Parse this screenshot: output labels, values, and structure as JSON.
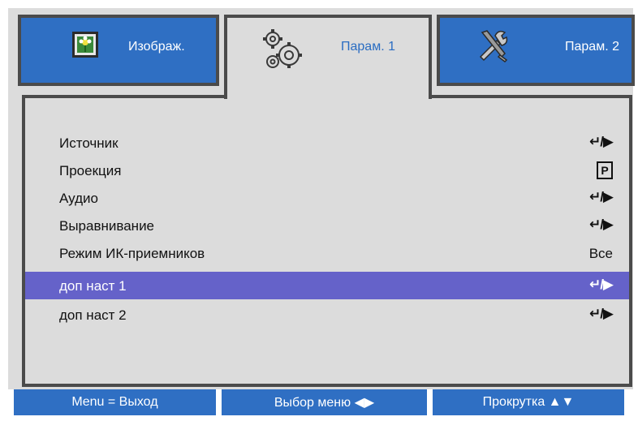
{
  "tabs": [
    {
      "label": "Изображ.",
      "icon": "image-icon",
      "active": false
    },
    {
      "label": "Парам. 1",
      "icon": "gears-icon",
      "active": true
    },
    {
      "label": "Парам. 2",
      "icon": "tools-icon",
      "active": false
    }
  ],
  "menu": [
    {
      "label": "Источник",
      "value": "↵/▶"
    },
    {
      "label": "Проекция",
      "value": "P"
    },
    {
      "label": "Аудио",
      "value": "↵/▶"
    },
    {
      "label": "Выравнивание",
      "value": "↵/▶"
    },
    {
      "label": "Режим ИК-приемников",
      "value": "Все"
    },
    {
      "label": "доп наст 1",
      "value": "↵/▶",
      "selected": true
    },
    {
      "label": "доп наст 2",
      "value": "↵/▶"
    }
  ],
  "footer": {
    "exit": "Menu = Выход",
    "select": "Выбор меню ◀▶",
    "scroll": "Прокрутка ▲▼"
  },
  "colors": {
    "tab_blue": "#2f6fc3",
    "selected_row": "#6562c9",
    "background": "#dcdcdc",
    "border": "#4b4b4b",
    "active_tab_text": "#2a6dc2"
  }
}
